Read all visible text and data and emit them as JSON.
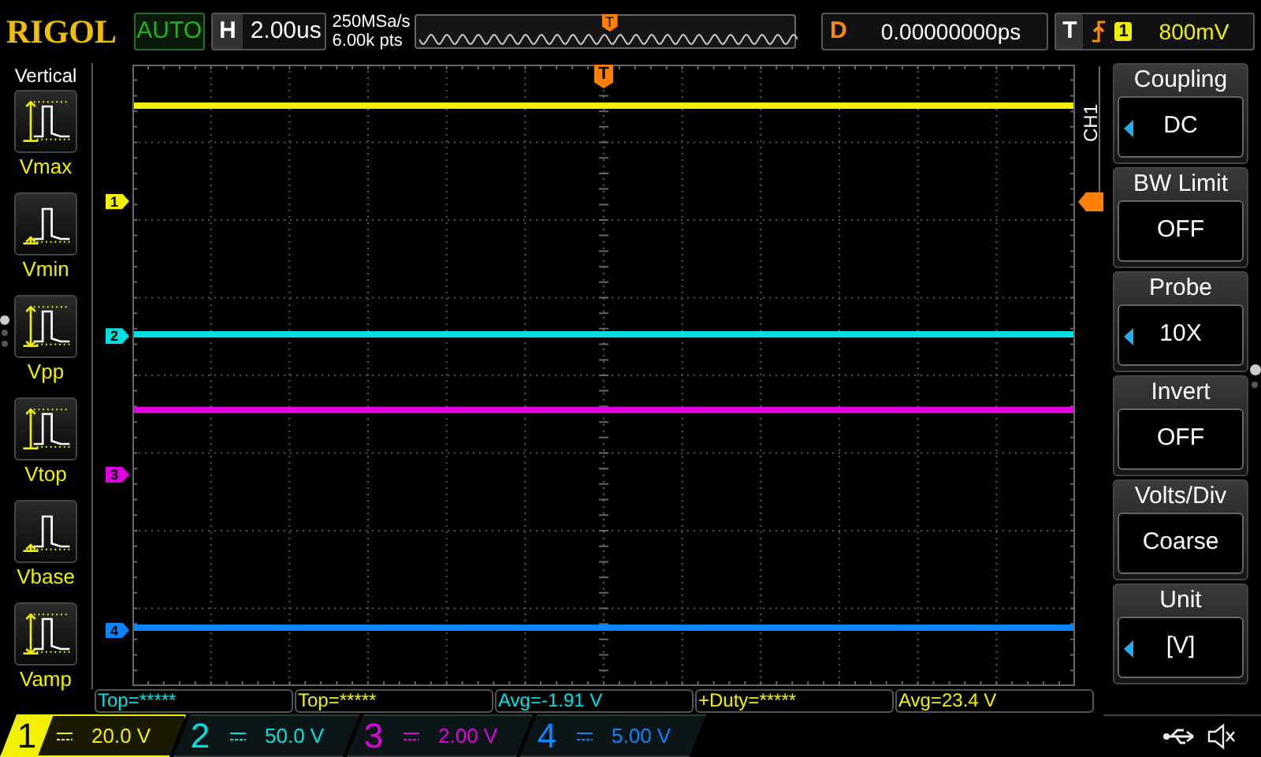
{
  "top_bar": {
    "brand": "RIGOL",
    "run_status": "AUTO",
    "horizontal": {
      "label": "H",
      "value": "2.00us"
    },
    "sample_rate": "250MSa/s",
    "memory_depth": "6.00k pts",
    "overview_trigger": "T",
    "delay": {
      "label": "D",
      "value": "0.00000000ps"
    },
    "trigger": {
      "label": "T",
      "source": "1",
      "level": "800mV"
    }
  },
  "sidebar": {
    "title": "Vertical",
    "items": [
      {
        "kind": "vmax",
        "label": "Vmax"
      },
      {
        "kind": "vmin",
        "label": "Vmin"
      },
      {
        "kind": "vpp",
        "label": "Vpp"
      },
      {
        "kind": "vtop",
        "label": "Vtop"
      },
      {
        "kind": "vbase",
        "label": "Vbase"
      },
      {
        "kind": "vamp",
        "label": "Vamp"
      }
    ],
    "pages": [
      {
        "selected": true
      },
      {
        "selected": false
      },
      {
        "selected": false
      }
    ]
  },
  "display": {
    "trigger_marker": "T",
    "channel_label": "CH1",
    "channel_markers": [
      {
        "label": "1"
      },
      {
        "label": "2"
      },
      {
        "label": "3"
      },
      {
        "label": "4"
      }
    ]
  },
  "menu": {
    "items": [
      {
        "title": "Coupling",
        "value": "DC",
        "selectable": true
      },
      {
        "title": "BW Limit",
        "value": "OFF",
        "selectable": false
      },
      {
        "title": "Probe",
        "value": "10X",
        "selectable": true
      },
      {
        "title": "Invert",
        "value": "OFF",
        "selectable": false
      },
      {
        "title": "Volts/Div",
        "value": "Coarse",
        "selectable": false
      },
      {
        "title": "Unit",
        "value": "[V]",
        "selectable": true
      }
    ],
    "pages": [
      {
        "selected": true
      },
      {
        "selected": false
      }
    ]
  },
  "measurements": [
    {
      "text": "Top=*****",
      "color": "#00e0e0"
    },
    {
      "text": "Top=*****",
      "color": "#f0f000"
    },
    {
      "text": "Avg=-1.91 V",
      "color": "#00e0e0"
    },
    {
      "text": "+Duty=*****",
      "color": "#f0f000"
    },
    {
      "text": "Avg=23.4 V",
      "color": "#f0f000"
    }
  ],
  "channels": [
    {
      "number": "1",
      "scale": "20.0 V",
      "color": "#f0f000",
      "selected": true
    },
    {
      "number": "2",
      "scale": "50.0 V",
      "color": "#00e0e0",
      "selected": false
    },
    {
      "number": "3",
      "scale": "2.00 V",
      "color": "#e000e0",
      "selected": false
    },
    {
      "number": "4",
      "scale": "5.00 V",
      "color": "#0a84ff",
      "selected": false
    }
  ]
}
